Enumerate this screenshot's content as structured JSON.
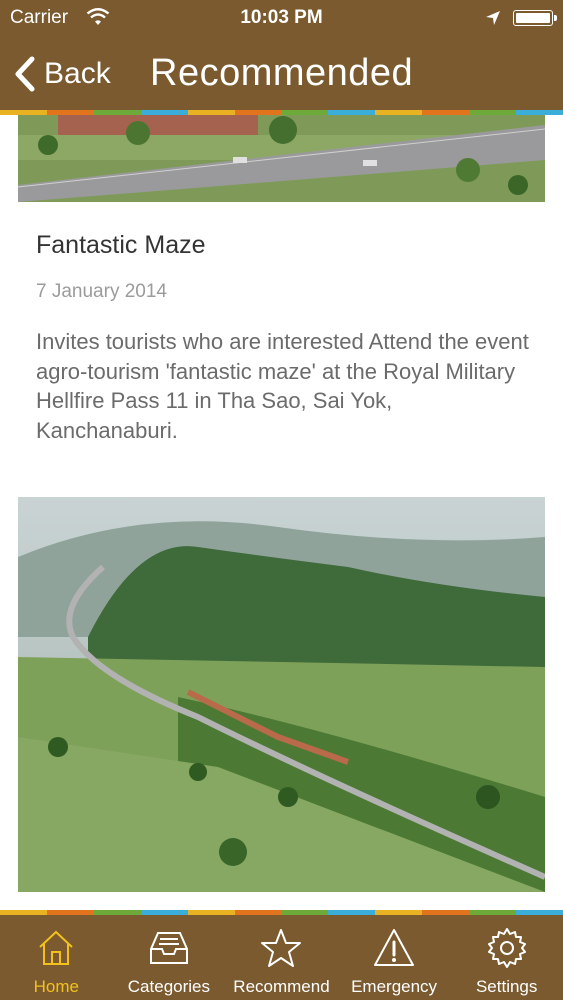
{
  "status_bar": {
    "carrier": "Carrier",
    "time": "10:03 PM"
  },
  "nav": {
    "back_label": "Back",
    "title": "Recommended"
  },
  "stripe_colors": [
    "#e8b223",
    "#e2741d",
    "#6eaa3a",
    "#3aaed8",
    "#e8b223",
    "#e2741d",
    "#6eaa3a",
    "#3aaed8",
    "#e8b223",
    "#e2741d",
    "#6eaa3a",
    "#3aaed8"
  ],
  "article": {
    "title": "Fantastic Maze",
    "date": "7 January 2014",
    "description": "Invites tourists who are interested Attend the event agro-tourism 'fantastic maze' at the Royal Military Hellfire Pass 11 in Tha Sao, Sai Yok, Kanchanaburi."
  },
  "tabs": [
    {
      "label": "Home",
      "icon": "home-icon",
      "active": true
    },
    {
      "label": "Categories",
      "icon": "categories-icon",
      "active": false
    },
    {
      "label": "Recommend",
      "icon": "star-icon",
      "active": false
    },
    {
      "label": "Emergency",
      "icon": "warning-icon",
      "active": false
    },
    {
      "label": "Settings",
      "icon": "gear-icon",
      "active": false
    }
  ],
  "colors": {
    "header_bg": "#7a5a2e",
    "active_tab": "#f3c11d"
  }
}
